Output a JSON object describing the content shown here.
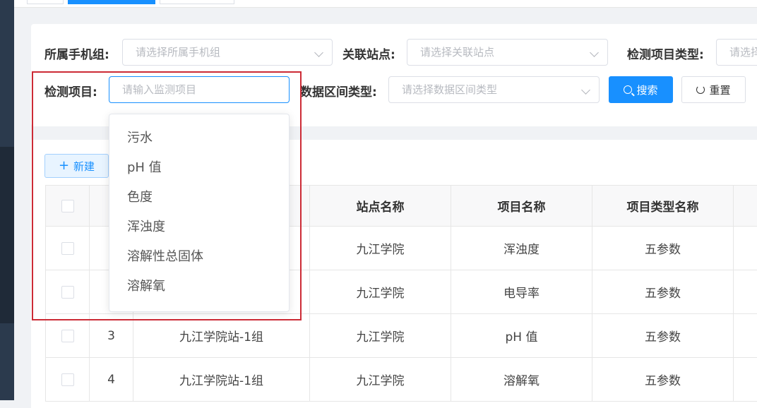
{
  "filters": {
    "group_label": "所属手机组:",
    "group_placeholder": "请选择所属手机组",
    "station_label": "关联站点:",
    "station_placeholder": "请选择关联站点",
    "item_type_label": "检测项目类型:",
    "item_type_placeholder": "请选择",
    "item_label": "检测项目:",
    "item_placeholder": "请输入监测项目",
    "range_label": "数据区间类型:",
    "range_placeholder": "请选择数据区间类型",
    "search_label": "搜索",
    "reset_label": "重置"
  },
  "dropdown": {
    "options": [
      "污水",
      "pH 值",
      "色度",
      "浑浊度",
      "溶解性总固体",
      "溶解氧"
    ]
  },
  "toolbar": {
    "new_label": "新建"
  },
  "table": {
    "headers": [
      "",
      "",
      "",
      "站点名称",
      "项目名称",
      "项目类型名称",
      ""
    ],
    "rows": [
      {
        "index": "",
        "group": "",
        "station": "九江学院",
        "item": "浑浊度",
        "type": "五参数"
      },
      {
        "index": "",
        "group": "",
        "station": "九江学院",
        "item": "电导率",
        "type": "五参数"
      },
      {
        "index": "3",
        "group": "九江学院站-1组",
        "station": "九江学院",
        "item": "pH 值",
        "type": "五参数"
      },
      {
        "index": "4",
        "group": "九江学院站-1组",
        "station": "九江学院",
        "item": "溶解氧",
        "type": "五参数"
      }
    ]
  },
  "colors": {
    "primary": "#1890ff",
    "highlight": "#cc2b36"
  }
}
